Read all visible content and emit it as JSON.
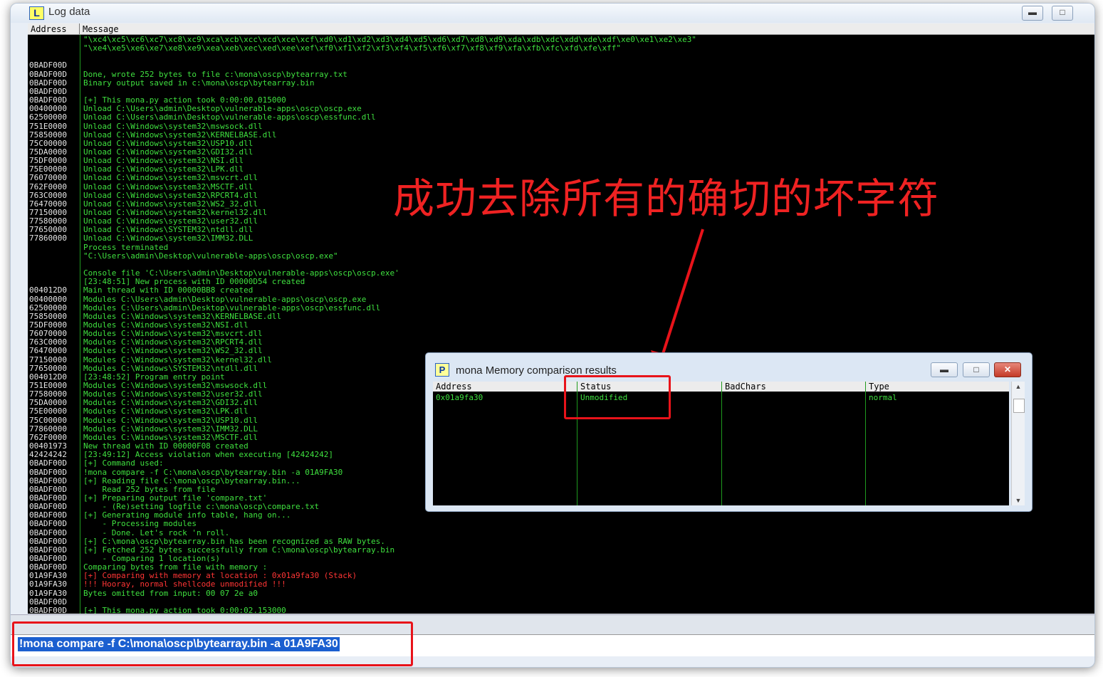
{
  "window": {
    "title": "Log data",
    "icon_letter": "L"
  },
  "log": {
    "columns": {
      "address": "Address",
      "message": "Message"
    },
    "lines": [
      {
        "a": "",
        "m": "\"\\xc4\\xc5\\xc6\\xc7\\xc8\\xc9\\xca\\xcb\\xcc\\xcd\\xce\\xcf\\xd0\\xd1\\xd2\\xd3\\xd4\\xd5\\xd6\\xd7\\xd8\\xd9\\xda\\xdb\\xdc\\xdd\\xde\\xdf\\xe0\\xe1\\xe2\\xe3\""
      },
      {
        "a": "",
        "m": "\"\\xe4\\xe5\\xe6\\xe7\\xe8\\xe9\\xea\\xeb\\xec\\xed\\xee\\xef\\xf0\\xf1\\xf2\\xf3\\xf4\\xf5\\xf6\\xf7\\xf8\\xf9\\xfa\\xfb\\xfc\\xfd\\xfe\\xff\""
      },
      {
        "a": "",
        "m": ""
      },
      {
        "a": "0BADF00D",
        "m": ""
      },
      {
        "a": "0BADF00D",
        "m": "Done, wrote 252 bytes to file c:\\mona\\oscp\\bytearray.txt"
      },
      {
        "a": "0BADF00D",
        "m": "Binary output saved in c:\\mona\\oscp\\bytearray.bin"
      },
      {
        "a": "0BADF00D",
        "m": ""
      },
      {
        "a": "0BADF00D",
        "m": "[+] This mona.py action took 0:00:00.015000"
      },
      {
        "a": "00400000",
        "m": "Unload C:\\Users\\admin\\Desktop\\vulnerable-apps\\oscp\\oscp.exe"
      },
      {
        "a": "62500000",
        "m": "Unload C:\\Users\\admin\\Desktop\\vulnerable-apps\\oscp\\essfunc.dll"
      },
      {
        "a": "751E0000",
        "m": "Unload C:\\Windows\\system32\\mswsock.dll"
      },
      {
        "a": "75850000",
        "m": "Unload C:\\Windows\\system32\\KERNELBASE.dll"
      },
      {
        "a": "75C00000",
        "m": "Unload C:\\Windows\\system32\\USP10.dll"
      },
      {
        "a": "75DA0000",
        "m": "Unload C:\\Windows\\system32\\GDI32.dll"
      },
      {
        "a": "75DF0000",
        "m": "Unload C:\\Windows\\system32\\NSI.dll"
      },
      {
        "a": "75E00000",
        "m": "Unload C:\\Windows\\system32\\LPK.dll"
      },
      {
        "a": "76070000",
        "m": "Unload C:\\Windows\\system32\\msvcrt.dll"
      },
      {
        "a": "762F0000",
        "m": "Unload C:\\Windows\\system32\\MSCTF.dll"
      },
      {
        "a": "763C0000",
        "m": "Unload C:\\Windows\\system32\\RPCRT4.dll"
      },
      {
        "a": "76470000",
        "m": "Unload C:\\Windows\\system32\\WS2_32.dll"
      },
      {
        "a": "77150000",
        "m": "Unload C:\\Windows\\system32\\kernel32.dll"
      },
      {
        "a": "77580000",
        "m": "Unload C:\\Windows\\system32\\user32.dll"
      },
      {
        "a": "77650000",
        "m": "Unload C:\\Windows\\SYSTEM32\\ntdll.dll"
      },
      {
        "a": "77860000",
        "m": "Unload C:\\Windows\\system32\\IMM32.DLL"
      },
      {
        "a": "",
        "m": "Process terminated"
      },
      {
        "a": "",
        "m": "\"C:\\Users\\admin\\Desktop\\vulnerable-apps\\oscp\\oscp.exe\""
      },
      {
        "a": "",
        "m": ""
      },
      {
        "a": "",
        "m": "Console file 'C:\\Users\\admin\\Desktop\\vulnerable-apps\\oscp\\oscp.exe'"
      },
      {
        "a": "",
        "m": "[23:48:51] New process with ID 00000D54 created"
      },
      {
        "a": "004012D0",
        "m": "Main thread with ID 00000BB8 created"
      },
      {
        "a": "00400000",
        "m": "Modules C:\\Users\\admin\\Desktop\\vulnerable-apps\\oscp\\oscp.exe"
      },
      {
        "a": "62500000",
        "m": "Modules C:\\Users\\admin\\Desktop\\vulnerable-apps\\oscp\\essfunc.dll"
      },
      {
        "a": "75850000",
        "m": "Modules C:\\Windows\\system32\\KERNELBASE.dll"
      },
      {
        "a": "75DF0000",
        "m": "Modules C:\\Windows\\system32\\NSI.dll"
      },
      {
        "a": "76070000",
        "m": "Modules C:\\Windows\\system32\\msvcrt.dll"
      },
      {
        "a": "763C0000",
        "m": "Modules C:\\Windows\\system32\\RPCRT4.dll"
      },
      {
        "a": "76470000",
        "m": "Modules C:\\Windows\\system32\\WS2_32.dll"
      },
      {
        "a": "77150000",
        "m": "Modules C:\\Windows\\system32\\kernel32.dll"
      },
      {
        "a": "77650000",
        "m": "Modules C:\\Windows\\SYSTEM32\\ntdll.dll"
      },
      {
        "a": "004012D0",
        "m": "[23:48:52] Program entry point"
      },
      {
        "a": "751E0000",
        "m": "Modules C:\\Windows\\system32\\mswsock.dll"
      },
      {
        "a": "77580000",
        "m": "Modules C:\\Windows\\system32\\user32.dll"
      },
      {
        "a": "75DA0000",
        "m": "Modules C:\\Windows\\system32\\GDI32.dll"
      },
      {
        "a": "75E00000",
        "m": "Modules C:\\Windows\\system32\\LPK.dll"
      },
      {
        "a": "75C00000",
        "m": "Modules C:\\Windows\\system32\\USP10.dll"
      },
      {
        "a": "77860000",
        "m": "Modules C:\\Windows\\system32\\IMM32.DLL"
      },
      {
        "a": "762F0000",
        "m": "Modules C:\\Windows\\system32\\MSCTF.dll"
      },
      {
        "a": "00401973",
        "m": "New thread with ID 00000F08 created"
      },
      {
        "a": "42424242",
        "m": "[23:49:12] Access violation when executing [42424242]"
      },
      {
        "a": "0BADF00D",
        "m": "[+] Command used:"
      },
      {
        "a": "0BADF00D",
        "m": "!mona compare -f C:\\mona\\oscp\\bytearray.bin -a 01A9FA30"
      },
      {
        "a": "0BADF00D",
        "m": "[+] Reading file C:\\mona\\oscp\\bytearray.bin..."
      },
      {
        "a": "0BADF00D",
        "m": "    Read 252 bytes from file"
      },
      {
        "a": "0BADF00D",
        "m": "[+] Preparing output file 'compare.txt'"
      },
      {
        "a": "0BADF00D",
        "m": "    - (Re)setting logfile c:\\mona\\oscp\\compare.txt"
      },
      {
        "a": "0BADF00D",
        "m": "[+] Generating module info table, hang on..."
      },
      {
        "a": "0BADF00D",
        "m": "    - Processing modules"
      },
      {
        "a": "0BADF00D",
        "m": "    - Done. Let's rock 'n roll."
      },
      {
        "a": "0BADF00D",
        "m": "[+] C:\\mona\\oscp\\bytearray.bin has been recognized as RAW bytes."
      },
      {
        "a": "0BADF00D",
        "m": "[+] Fetched 252 bytes successfully from C:\\mona\\oscp\\bytearray.bin"
      },
      {
        "a": "0BADF00D",
        "m": "    - Comparing 1 location(s)"
      },
      {
        "a": "0BADF00D",
        "m": "Comparing bytes from file with memory :"
      },
      {
        "a": "01A9FA30",
        "m": "[+] Comparing with memory at location : 0x01a9fa30 (Stack)",
        "red": true
      },
      {
        "a": "01A9FA30",
        "m": "!!! Hooray, normal shellcode unmodified !!!",
        "red": true
      },
      {
        "a": "01A9FA30",
        "m": "Bytes omitted from input: 00 07 2e a0"
      },
      {
        "a": "0BADF00D",
        "m": ""
      },
      {
        "a": "0BADF00D",
        "m": "[+] This mona.py action took 0:00:02.153000"
      }
    ]
  },
  "annotation": {
    "text": "成功去除所有的确切的坏字符"
  },
  "mona_window": {
    "title": "mona Memory comparison results",
    "icon_letter": "P",
    "columns": [
      "Address",
      "Status",
      "BadChars",
      "Type"
    ],
    "row": {
      "address": "0x01a9fa30",
      "status": "Unmodified",
      "badchars": "",
      "type": "normal"
    }
  },
  "command_bar": {
    "value": "!mona compare -f C:\\mona\\oscp\\bytearray.bin -a 01A9FA30"
  },
  "colors": {
    "annotation_red": "#e8131a",
    "log_green": "#3fe03f",
    "highlight_blue": "#1b5fd0"
  },
  "icons": {
    "minimize": "minimize-icon",
    "maximize": "maximize-icon",
    "close": "close-icon"
  }
}
